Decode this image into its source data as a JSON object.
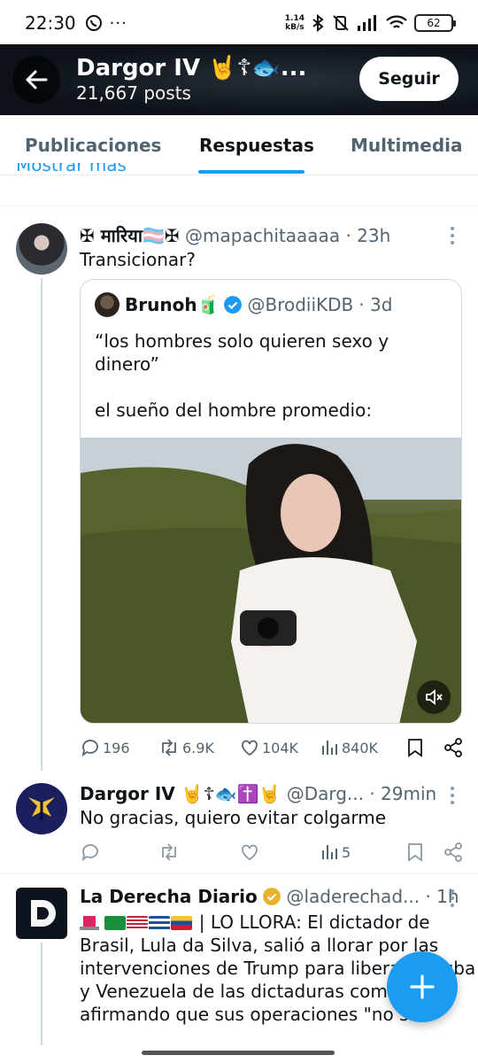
{
  "status_bar": {
    "time": "22:30",
    "net_speed_value": "1.14",
    "net_speed_unit": "kB/s",
    "battery": "62"
  },
  "header": {
    "display_name": "Dargor IV 🤘☦🐟...",
    "posts_count": "21,667 posts",
    "follow_label": "Seguir"
  },
  "tabs": [
    {
      "label": "Publicaciones",
      "active": false
    },
    {
      "label": "Respuestas",
      "active": true
    },
    {
      "label": "Multimedia",
      "active": false
    }
  ],
  "show_more": "Mostrar más",
  "tweets": [
    {
      "name": "✠ मारिया🏳️‍⚧️✠",
      "handle": "@mapachitaaaaa",
      "time": "· 23h",
      "text": "Transicionar?",
      "quote": {
        "name": "Brunoh🧃",
        "handle": "@BrodiiKDB",
        "time": "· 3d",
        "text_line1": "“los hombres solo quieren sexo y dinero”",
        "text_line2": "el sueño del hombre promedio:"
      },
      "stats": {
        "replies": "196",
        "reposts": "6.9K",
        "likes": "104K",
        "views": "840K"
      }
    },
    {
      "name": "Dargor IV 🤘☦🐟✝️🤘",
      "handle": "@Darg...",
      "time": "· 29min",
      "text": "No gracias, quiero evitar colgarme",
      "stats": {
        "replies": "",
        "reposts": "",
        "likes": "",
        "views": "5"
      }
    },
    {
      "name": "La Derecha Diario",
      "handle": "@laderechad...",
      "time": "· 1h",
      "text_lines": [
        "| LO LLORA: El dictador de",
        "Brasil, Lula da Silva, salió a llorar por las",
        "intervenciones de Trump para liberar a Cuba",
        "y Venezuela de las dictaduras comunistas,",
        "afirmando que sus operaciones \"no son"
      ]
    }
  ],
  "colors": {
    "accent": "#1d9bf0",
    "gold_verified": "#e8b32c",
    "text_primary": "#0f1419",
    "text_secondary": "#536471"
  },
  "icons": [
    "back-arrow-icon",
    "reply-icon",
    "repost-icon",
    "like-icon",
    "views-icon",
    "bookmark-icon",
    "share-icon",
    "mute-icon",
    "compose-plus-icon"
  ]
}
